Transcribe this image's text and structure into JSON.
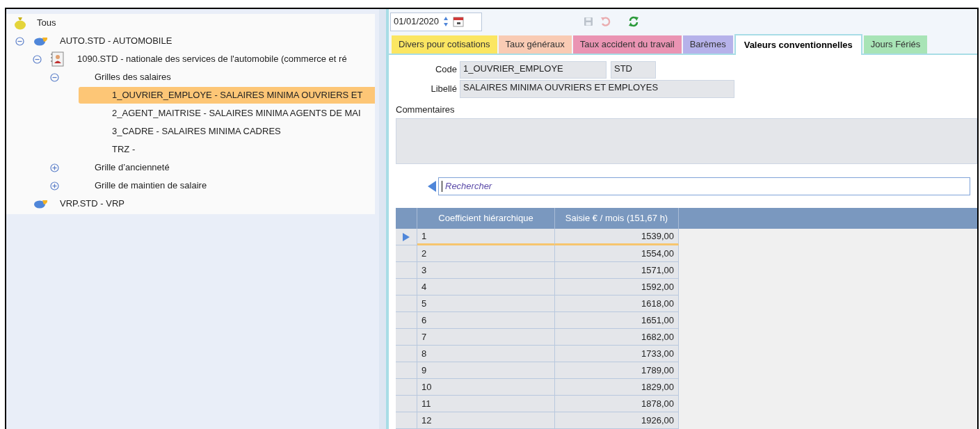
{
  "tree_root": {
    "label": "Tous"
  },
  "tree": [
    {
      "label": "AUTO.STD - AUTOMOBILE",
      "kind": "group",
      "expanded": true,
      "selected": false,
      "children": [
        {
          "label": "1090.STD - nationale des services de l'automobile (commerce et ré",
          "kind": "agreement",
          "expanded": true,
          "selected": false,
          "children": [
            {
              "label": "Grilles des salaires",
              "expanded": true,
              "selected": false,
              "children": [
                {
                  "label": "1_OUVRIER_EMPLOYE - SALAIRES MINIMA OUVRIERS ET",
                  "selected": true
                },
                {
                  "label": "2_AGENT_MAITRISE - SALAIRES MINIMA AGENTS DE MAI",
                  "selected": false
                },
                {
                  "label": "3_CADRE - SALAIRES MINIMA CADRES",
                  "selected": false
                },
                {
                  "label": "TRZ -",
                  "selected": false
                }
              ]
            },
            {
              "label": "Grille d’ancienneté",
              "expanded": false,
              "selected": false
            },
            {
              "label": "Grille de maintien de salaire",
              "expanded": false,
              "selected": false
            }
          ]
        }
      ]
    },
    {
      "label": "VRP.STD - VRP",
      "kind": "group",
      "selected": false
    }
  ],
  "toolbar": {
    "date": "01/01/2020",
    "buttons": [
      {
        "kind": "save",
        "disabled": true
      },
      {
        "kind": "undo",
        "disabled": true
      },
      {
        "kind": "refresh",
        "disabled": false
      }
    ]
  },
  "tabs": [
    {
      "label": "Divers pour cotisations",
      "color": "#fbe662",
      "selected": false
    },
    {
      "label": "Taux généraux",
      "color": "#f9cbb4",
      "selected": false
    },
    {
      "label": "Taux accident du travail",
      "color": "#ea94b3",
      "selected": false
    },
    {
      "label": "Barèmes",
      "color": "#b6b2ea",
      "selected": false
    },
    {
      "label": "Valeurs conventionnelles",
      "color": "#ffffff",
      "selected": true
    },
    {
      "label": "Jours Fériés",
      "color": "#a8e4b6",
      "selected": false
    }
  ],
  "form": {
    "code_label": "Code",
    "code": "1_OUVRIER_EMPLOYE",
    "code_suffix": "STD",
    "libelle_label": "Libellé",
    "libelle": "SALAIRES MINIMA OUVRIERS ET EMPLOYES",
    "comments_label": "Commentaires"
  },
  "search": {
    "placeholder": "Rechercher"
  },
  "table": {
    "columns": [
      "Coefficient hiérarchique",
      "Saisie € / mois (151,67 h)"
    ],
    "rows": [
      {
        "cells": [
          "1",
          "1539,00"
        ],
        "selected": true
      },
      {
        "cells": [
          "2",
          "1554,00"
        ],
        "selected": false
      },
      {
        "cells": [
          "3",
          "1571,00"
        ],
        "selected": false
      },
      {
        "cells": [
          "4",
          "1592,00"
        ],
        "selected": false
      },
      {
        "cells": [
          "5",
          "1618,00"
        ],
        "selected": false
      },
      {
        "cells": [
          "6",
          "1651,00"
        ],
        "selected": false
      },
      {
        "cells": [
          "7",
          "1682,00"
        ],
        "selected": false
      },
      {
        "cells": [
          "8",
          "1733,00"
        ],
        "selected": false
      },
      {
        "cells": [
          "9",
          "1789,00"
        ],
        "selected": false
      },
      {
        "cells": [
          "10",
          "1829,00"
        ],
        "selected": false
      },
      {
        "cells": [
          "11",
          "1878,00"
        ],
        "selected": false
      },
      {
        "cells": [
          "12",
          "1926,00"
        ],
        "selected": false
      }
    ]
  }
}
